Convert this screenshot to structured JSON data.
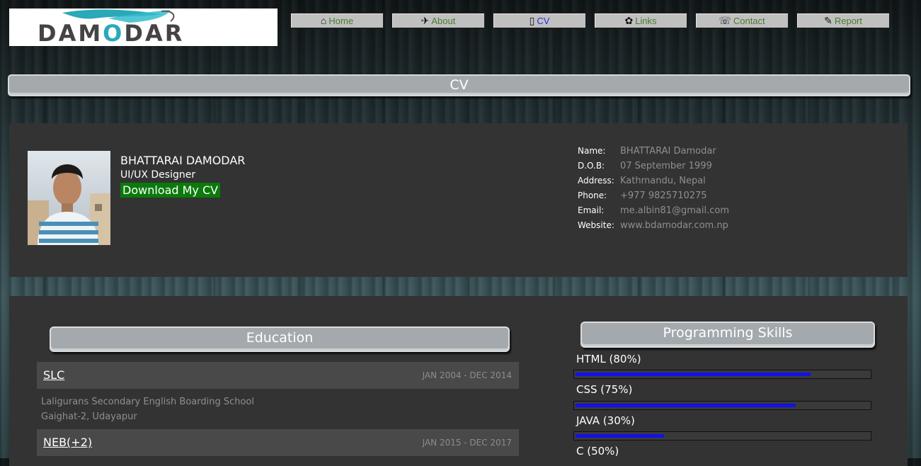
{
  "logo": {
    "text_main": "DAM",
    "text_accent": "O",
    "text_end": "DAR"
  },
  "nav": [
    {
      "label": "Home",
      "icon": "home-icon",
      "glyph": "⌂"
    },
    {
      "label": "About",
      "icon": "about-icon",
      "glyph": "✈"
    },
    {
      "label": "CV",
      "icon": "cv-icon",
      "glyph": "▯",
      "active": true
    },
    {
      "label": "Links",
      "icon": "links-icon",
      "glyph": "✿"
    },
    {
      "label": "Contact",
      "icon": "contact-icon",
      "glyph": "☏"
    },
    {
      "label": "Report",
      "icon": "report-icon",
      "glyph": "✎"
    }
  ],
  "banner": {
    "title": "CV"
  },
  "profile": {
    "name": "BHATTARAI DAMODAR",
    "role": "UI/UX Designer",
    "download_label": "Download My CV",
    "info": [
      {
        "key": "Name:",
        "value": "BHATTARAI Damodar"
      },
      {
        "key": "D.O.B:",
        "value": "07 September 1999"
      },
      {
        "key": "Address:",
        "value": "Kathmandu, Nepal"
      },
      {
        "key": "Phone:",
        "value": "+977 9825710275"
      },
      {
        "key": "Email:",
        "value": "me.albin81@gmail.com"
      },
      {
        "key": "Website:",
        "value": "www.bdamodar.com.np"
      }
    ]
  },
  "education": {
    "title": "Education",
    "entries": [
      {
        "title": "SLC",
        "dates": "JAN 2004 - DEC 2014",
        "details": [
          "Laligurans Secondary English Boarding School",
          "Gaighat-2, Udayapur"
        ]
      },
      {
        "title": "NEB(+2)",
        "dates": "JAN 2015 - DEC 2017",
        "details": []
      }
    ]
  },
  "skills": {
    "title": "Programming Skills",
    "items": [
      {
        "label": "HTML (80%)",
        "percent": 80
      },
      {
        "label": "CSS (75%)",
        "percent": 75
      },
      {
        "label": "JAVA (30%)",
        "percent": 30
      },
      {
        "label": "C (50%)",
        "percent": 50
      }
    ]
  },
  "colors": {
    "nav_text": "#4a7a2c",
    "nav_active": "#2b2bd6",
    "download_bg": "#0b7a0b",
    "skill_bar": "#1212e6"
  }
}
